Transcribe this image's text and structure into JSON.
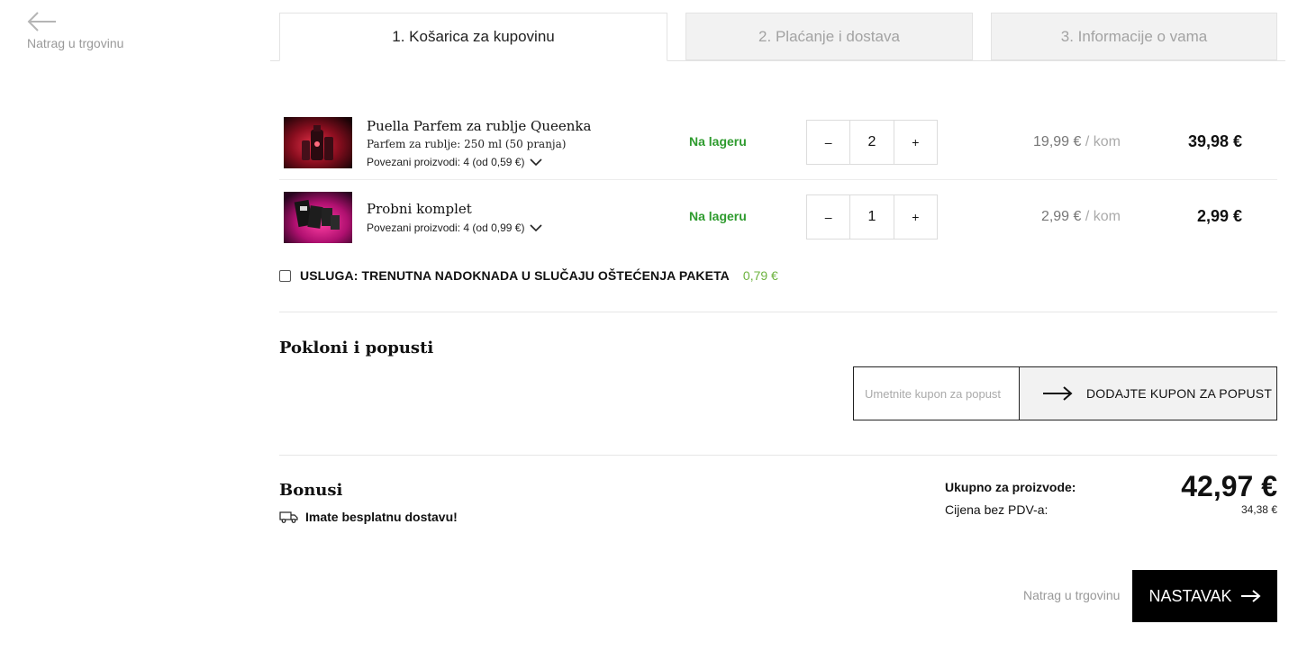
{
  "nav": {
    "back_label": "Natrag u trgovinu"
  },
  "steps": [
    {
      "label": "1. Košarica za kupovinu",
      "active": true
    },
    {
      "label": "2. Plaćanje i dostava",
      "active": false
    },
    {
      "label": "3. Informacije o vama",
      "active": false
    }
  ],
  "cart": {
    "items": [
      {
        "name": "Puella Parfem za rublje Queenka",
        "subtitle": "Parfem za rublje: 250 ml (50 pranja)",
        "related": "Povezani proizvodi: 4 (od 0,59 €)",
        "stock": "Na lageru",
        "qty": "2",
        "unit_price": "19,99 €",
        "unit_suffix": "/ kom",
        "total": "39,98 €"
      },
      {
        "name": "Probni komplet",
        "related": "Povezani proizvodi: 4 (od 0,99 €)",
        "stock": "Na lageru",
        "qty": "1",
        "unit_price": "2,99 €",
        "unit_suffix": "/ kom",
        "total": "2,99 €"
      }
    ],
    "qty_minus": "–",
    "qty_plus": "+",
    "service": {
      "label": "USLUGA: TRENUTNA NADOKNADA U SLUČAJU OŠTEĆENJA PAKETA",
      "price": "0,79 €",
      "checked": false
    }
  },
  "gifts": {
    "title": "Pokloni i popusti",
    "coupon_placeholder": "Umetnite kupon za popust",
    "coupon_button": "DODAJTE KUPON ZA POPUST"
  },
  "bonuses": {
    "title": "Bonusi",
    "free_shipping": "Imate besplatnu dostavu!"
  },
  "summary": {
    "total_label": "Ukupno za proizvode:",
    "total_value": "42,97 €",
    "net_label": "Cijena bez PDV-a:",
    "net_value": "34,38 €"
  },
  "footer": {
    "back_label": "Natrag u trgovinu",
    "continue_label": "NASTAVAK"
  },
  "colors": {
    "in_stock": "#2e9b2e",
    "service_price": "#6db33f",
    "cta_bg": "#000000"
  },
  "icons": [
    "back-arrow-icon",
    "chevron-down-icon",
    "truck-icon",
    "arrow-right-icon"
  ]
}
